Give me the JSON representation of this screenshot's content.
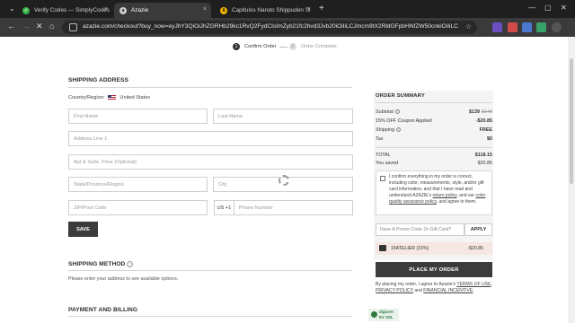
{
  "browser": {
    "tabs": [
      {
        "label": "Verify Codes — SimplyCodes",
        "icon": "check-circle-icon",
        "icon_color": "#39b54a"
      },
      {
        "label": "Azazie",
        "icon": "azazie-logo-icon",
        "icon_color": "#cfcfcf"
      },
      {
        "label": "Capitulos Naruto Shippuden Si",
        "icon": "site-logo-icon",
        "icon_color": "#f2b400"
      }
    ],
    "url": "azazie.com/checkout?buy_now=eyJhY3QiOiJhZGRHb29kc1RvQ2FydCIsImZyb21fc2hvd3Jvb20iOiIiLCJmcm9tX2RldGFpbHNfZW50cnkiOiIiLCJmcm9tX3",
    "accent": "#1f1f1f"
  },
  "steps": [
    {
      "num": "1",
      "label": "Confirm Order"
    },
    {
      "num": "2",
      "label": "Order Complete"
    }
  ],
  "shipping": {
    "title": "SHIPPING ADDRESS",
    "country_label": "Country/Region:",
    "country_value": "United States",
    "placeholders": {
      "first_name": "First Name",
      "last_name": "Last Name",
      "address1": "Address Line 1",
      "address2": "Apt & Suite, Floor (Optional)",
      "state": "State/Province/Region",
      "city": "City",
      "zip": "ZIP/Post Code",
      "phone": "Phone Number"
    },
    "country_code": "US +1",
    "save_label": "SAVE"
  },
  "shipping_method": {
    "title": "SHIPPING METHOD",
    "note": "Please enter your address to see available options."
  },
  "payment": {
    "title": "PAYMENT AND BILLING"
  },
  "summary": {
    "title": "ORDER SUMMARY",
    "subtotal_label": "Subtotal",
    "subtotal_value": "$139",
    "subtotal_original": "$149",
    "coupon_label": "15% OFF Coupon Applied",
    "coupon_value": "-$20.85",
    "shipping_label": "Shipping",
    "shipping_value": "FREE",
    "tax_label": "Tax",
    "tax_value": "$0",
    "total_label": "TOTAL",
    "total_value": "$118.15",
    "saved_label": "You saved",
    "saved_value": "$20.85",
    "confirm_text_1": "I confirm everything in my order is correct, including color, measurements, style, and/or gift card information, and that I have read and understand AZAZIE's",
    "return_policy": "return policy",
    "and_our": ", and our",
    "color_policy": "color quality assurance policy",
    "confirm_text_2": ", and agree to them.",
    "promo_placeholder": "Have A Promo Code Or Gift Card?",
    "apply_label": "APPLY",
    "applied_code": "15ATELIER (15%)",
    "applied_amount": "-$20.85",
    "place_order_label": "PLACE MY ORDER",
    "terms_prefix": "By placing my order, I agree to Azazie's",
    "terms_link": "TERMS OF USE",
    "privacy_link": "PRIVACY POLICY",
    "terms_and": "and",
    "incentive_link": "FINANCIAL INCENTIVE",
    "badge_line1": "digicert",
    "badge_line2": "EV SSL"
  }
}
